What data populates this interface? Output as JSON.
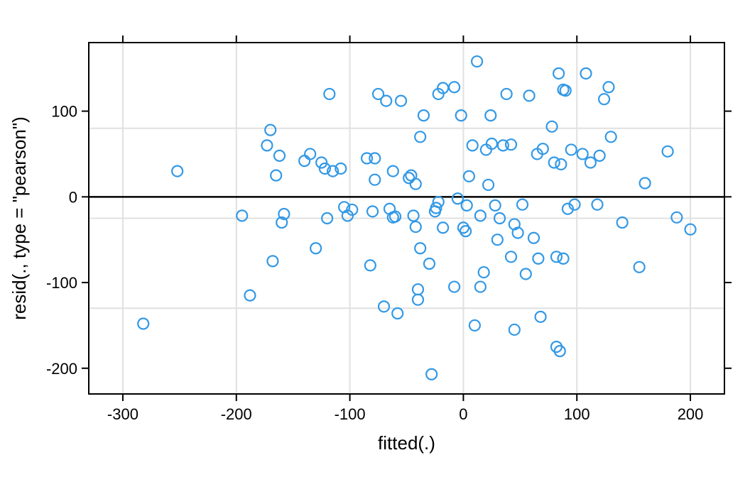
{
  "chart_data": {
    "type": "scatter",
    "title": "",
    "xlabel": "fitted(.)",
    "ylabel": "resid(., type = \"pearson\")",
    "xlim": [
      -330,
      230
    ],
    "ylim": [
      -230,
      180
    ],
    "x_ticks": [
      -300,
      -200,
      -100,
      0,
      100,
      200
    ],
    "y_ticks": [
      -200,
      -100,
      0,
      100
    ],
    "grid_x": [
      -300,
      -200,
      -100,
      0,
      100,
      200
    ],
    "grid_y_approx": [
      -130,
      -25,
      80
    ],
    "ref_y": 0,
    "point_color": "#3399e6",
    "x": [
      -282,
      -252,
      -195,
      -188,
      -173,
      -170,
      -168,
      -165,
      -162,
      -160,
      -158,
      -140,
      -135,
      -130,
      -125,
      -122,
      -120,
      -118,
      -115,
      -108,
      -105,
      -102,
      -98,
      -85,
      -82,
      -80,
      -78,
      -78,
      -75,
      -70,
      -68,
      -65,
      -62,
      -62,
      -60,
      -58,
      -55,
      -48,
      -46,
      -44,
      -42,
      -42,
      -40,
      -40,
      -38,
      -38,
      -35,
      -30,
      -28,
      -25,
      -24,
      -22,
      -22,
      -18,
      -18,
      -8,
      -8,
      -5,
      -2,
      0,
      2,
      3,
      5,
      8,
      10,
      12,
      15,
      15,
      18,
      20,
      22,
      24,
      25,
      28,
      30,
      32,
      35,
      38,
      42,
      42,
      45,
      45,
      48,
      52,
      55,
      58,
      62,
      65,
      66,
      68,
      70,
      78,
      80,
      82,
      82,
      84,
      85,
      86,
      88,
      88,
      90,
      92,
      95,
      98,
      105,
      108,
      112,
      118,
      120,
      124,
      128,
      130,
      140,
      155,
      160,
      180,
      188,
      200
    ],
    "y": [
      -148,
      30,
      -22,
      -115,
      60,
      78,
      -75,
      25,
      48,
      -30,
      -20,
      42,
      50,
      -60,
      40,
      33,
      -25,
      120,
      30,
      33,
      -12,
      -22,
      -15,
      45,
      -80,
      -17,
      20,
      45,
      120,
      -128,
      112,
      -14,
      -24,
      30,
      -23,
      -136,
      112,
      22,
      25,
      -22,
      -35,
      15,
      -108,
      -120,
      -60,
      70,
      95,
      -78,
      -207,
      -17,
      -13,
      120,
      -6,
      -36,
      127,
      -105,
      128,
      -2,
      95,
      -36,
      -40,
      -10,
      24,
      60,
      -150,
      158,
      -22,
      -105,
      -88,
      55,
      14,
      95,
      62,
      -10,
      -50,
      -25,
      60,
      120,
      -70,
      61,
      -32,
      -155,
      -42,
      -9,
      -90,
      118,
      -48,
      50,
      -72,
      -140,
      56,
      82,
      40,
      -70,
      -175,
      144,
      -180,
      38,
      -72,
      125,
      124,
      -14,
      55,
      -9,
      50,
      144,
      40,
      -9,
      48,
      114,
      128,
      70,
      -30,
      -82,
      16,
      53,
      -24,
      -38
    ]
  }
}
